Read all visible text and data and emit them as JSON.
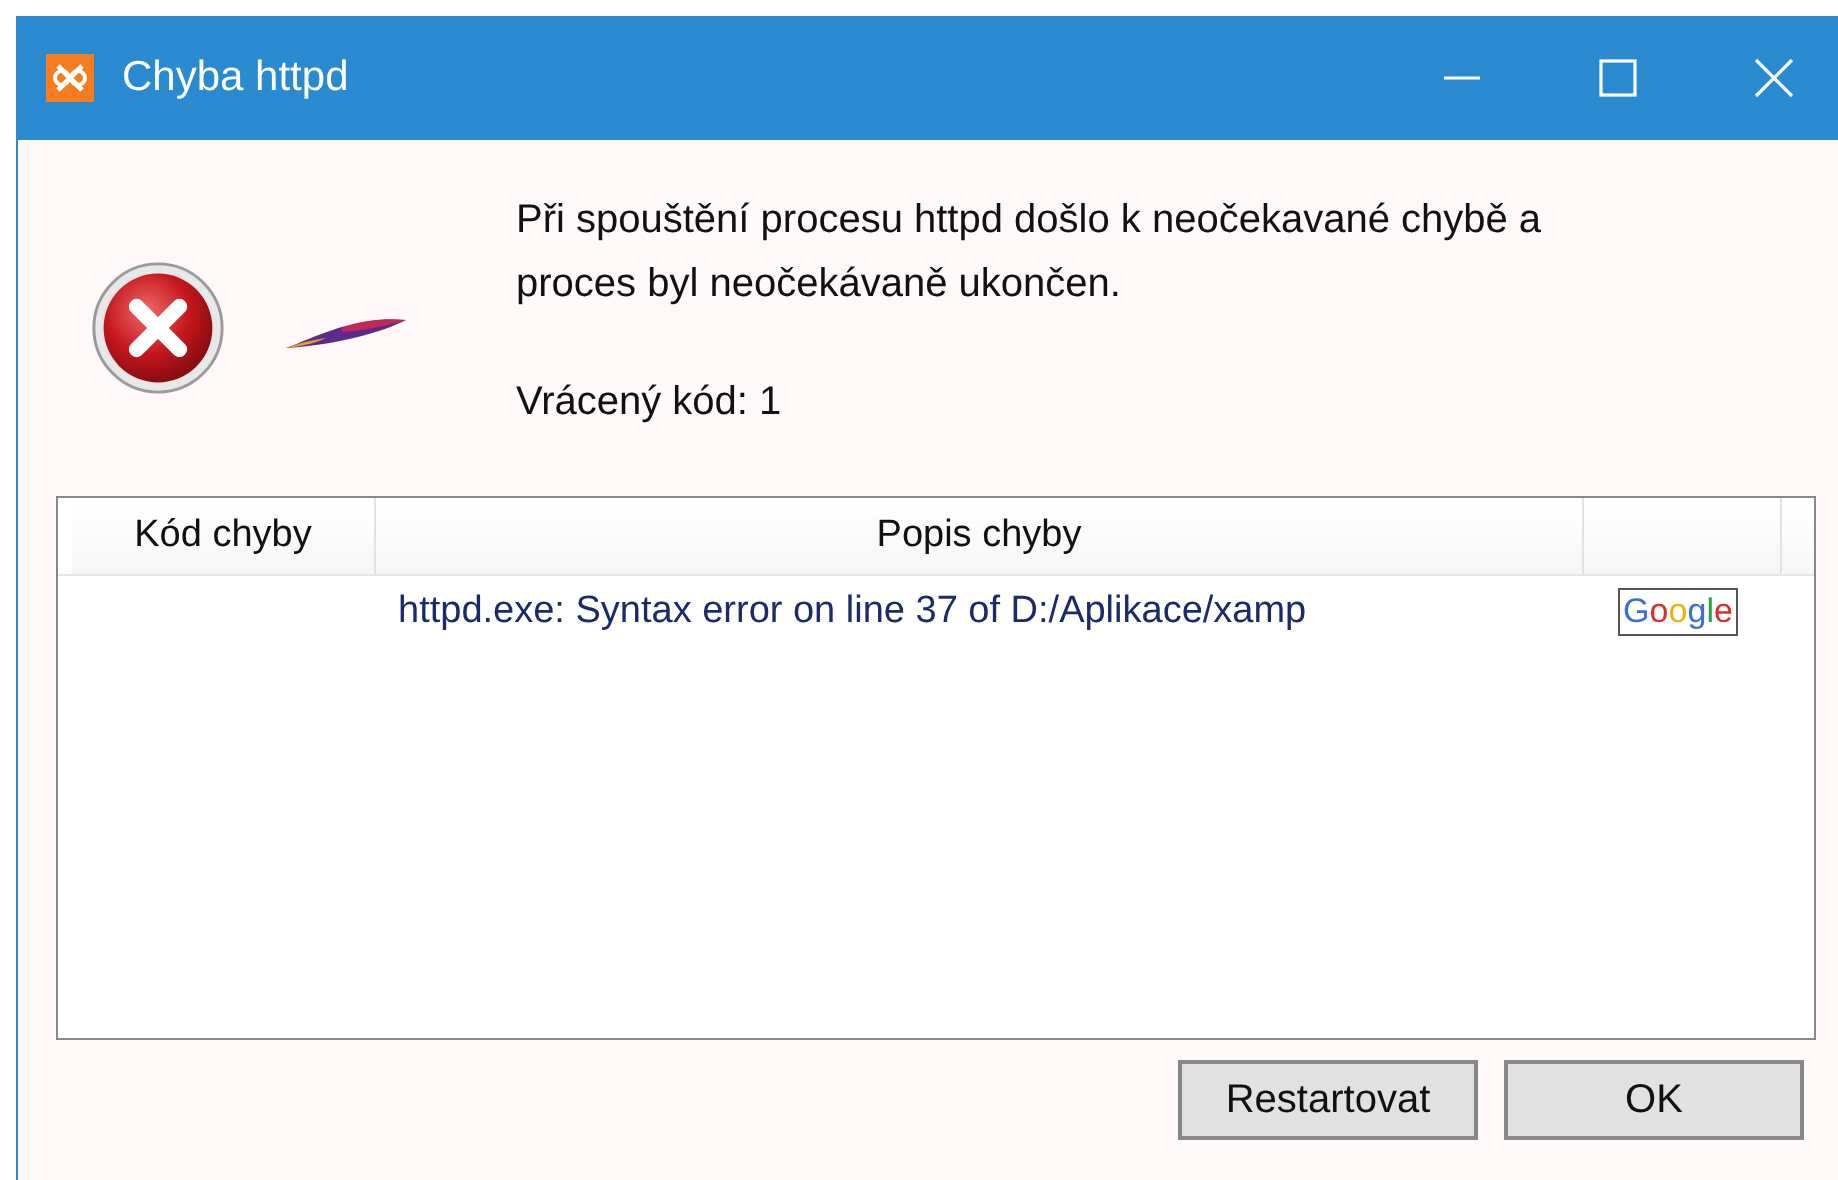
{
  "window": {
    "title": "Chyba httpd"
  },
  "message": {
    "lines": [
      "Při spouštění procesu httpd došlo k neočekavané chybě a",
      "proces byl neočekávaně ukončen."
    ],
    "return_code": "Vrácený kód: 1"
  },
  "table": {
    "columns": [
      "Kód chyby",
      "Popis chyby"
    ],
    "rows": [
      {
        "description": "httpd.exe: Syntax error on line 37 of D:/Aplikace/xamp",
        "search_button": "Google"
      }
    ]
  },
  "buttons": [
    {
      "label": "Restartovat"
    },
    {
      "label": "OK"
    }
  ]
}
